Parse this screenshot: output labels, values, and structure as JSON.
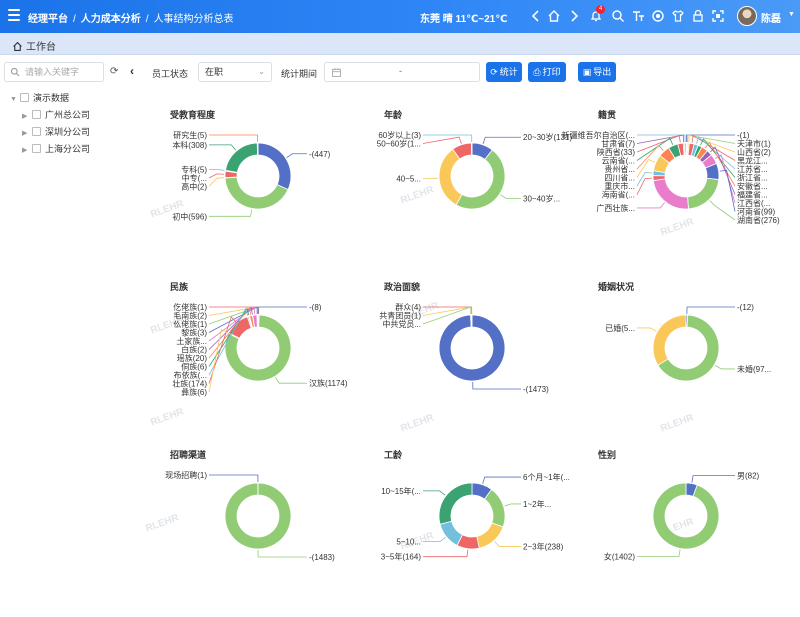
{
  "header": {
    "breadcrumb": [
      "经理平台",
      "人力成本分析",
      "人事结构分析总表"
    ],
    "weather": "东莞 晴 11℃~21℃",
    "notification_count": "4",
    "user_name": "陈磊"
  },
  "tabs": {
    "home_label": "工作台"
  },
  "sidebar": {
    "search_placeholder": "请输入关键字",
    "tree": [
      {
        "label": "演示数据",
        "level": 0
      },
      {
        "label": "广州总公司",
        "level": 1
      },
      {
        "label": "深圳分公司",
        "level": 1
      },
      {
        "label": "上海分公司",
        "level": 1
      }
    ]
  },
  "filters": {
    "status_label": "员工状态",
    "status_value": "在职",
    "period_label": "统计期间",
    "period_separator": "-"
  },
  "buttons": {
    "stat": "统计",
    "print": "打印",
    "export": "导出"
  },
  "watermark": "RLEHR",
  "chart_data": [
    {
      "type": "pie",
      "title": "受教育程度",
      "slices": [
        {
          "label": "-(447)",
          "value": 447,
          "color": "#5470c6"
        },
        {
          "label": "初中(596)",
          "value": 596,
          "color": "#91cc75"
        },
        {
          "label": "高中(2)",
          "value": 2,
          "color": "#fac858"
        },
        {
          "label": "中专(...",
          "value": 45,
          "color": "#ee6666"
        },
        {
          "label": "专科(5)",
          "value": 5,
          "color": "#73c0de"
        },
        {
          "label": "本科(308)",
          "value": 308,
          "color": "#3ba272"
        },
        {
          "label": "研究生(5)",
          "value": 5,
          "color": "#fc8452"
        }
      ]
    },
    {
      "type": "pie",
      "title": "年龄",
      "slices": [
        {
          "label": "20~30岁(131)",
          "value": 131,
          "color": "#5470c6"
        },
        {
          "label": "30~40岁...",
          "value": 590,
          "color": "#91cc75"
        },
        {
          "label": "40~5...",
          "value": 400,
          "color": "#fac858"
        },
        {
          "label": "50~60岁(1...",
          "value": 120,
          "color": "#ee6666"
        },
        {
          "label": "60岁以上(3)",
          "value": 3,
          "color": "#73c0de"
        }
      ]
    },
    {
      "type": "pie",
      "title": "籍贯",
      "slices": [
        {
          "label": "-(1)",
          "value": 6,
          "color": "#5470c6"
        },
        {
          "label": "天津市(1)",
          "value": 6,
          "color": "#91cc75"
        },
        {
          "label": "山西省(2)",
          "value": 8,
          "color": "#fac858"
        },
        {
          "label": "黑龙江...",
          "value": 30,
          "color": "#ee6666"
        },
        {
          "label": "江苏省...",
          "value": 25,
          "color": "#73c0de"
        },
        {
          "label": "浙江省...",
          "value": 25,
          "color": "#3ba272"
        },
        {
          "label": "安徽省...",
          "value": 40,
          "color": "#fc8452"
        },
        {
          "label": "福建省...",
          "value": 35,
          "color": "#9a60b4"
        },
        {
          "label": "江西省(...",
          "value": 60,
          "color": "#ea7ccc"
        },
        {
          "label": "河南省(99)",
          "value": 99,
          "color": "#5470c6"
        },
        {
          "label": "湖南省(276)",
          "value": 276,
          "color": "#91cc75"
        },
        {
          "label": "广西壮族...",
          "value": 300,
          "color": "#ea7ccc"
        },
        {
          "label": "海南省(...",
          "value": 30,
          "color": "#ee6666"
        },
        {
          "label": "重庆市...",
          "value": 30,
          "color": "#73c0de"
        },
        {
          "label": "四川省...",
          "value": 100,
          "color": "#fac858"
        },
        {
          "label": "贵州省...",
          "value": 70,
          "color": "#fc8452"
        },
        {
          "label": "云南省(...",
          "value": 60,
          "color": "#3ba272"
        },
        {
          "label": "陕西省(33)",
          "value": 33,
          "color": "#ee6666"
        },
        {
          "label": "甘肃省(7)",
          "value": 7,
          "color": "#9a60b4"
        },
        {
          "label": "新疆维吾尔自治区(...",
          "value": 10,
          "color": "#73c0de"
        }
      ]
    },
    {
      "type": "pie",
      "title": "民族",
      "slices": [
        {
          "label": "-(8)",
          "value": 8,
          "color": "#5470c6"
        },
        {
          "label": "汉族(1174)",
          "value": 1174,
          "color": "#91cc75"
        },
        {
          "label": "彝族(6)",
          "value": 6,
          "color": "#fac858"
        },
        {
          "label": "壮族(174)",
          "value": 174,
          "color": "#ee6666"
        },
        {
          "label": "布依族(...",
          "value": 10,
          "color": "#73c0de"
        },
        {
          "label": "侗族(6)",
          "value": 6,
          "color": "#3ba272"
        },
        {
          "label": "瑶族(20)",
          "value": 20,
          "color": "#fc8452"
        },
        {
          "label": "白族(2)",
          "value": 2,
          "color": "#9a60b4"
        },
        {
          "label": "土家族...",
          "value": 30,
          "color": "#ea7ccc"
        },
        {
          "label": "黎族(3)",
          "value": 3,
          "color": "#5470c6"
        },
        {
          "label": "仫佬族(1)",
          "value": 1,
          "color": "#91cc75"
        },
        {
          "label": "毛南族(2)",
          "value": 2,
          "color": "#fac858"
        },
        {
          "label": "仡佬族(1)",
          "value": 1,
          "color": "#ee6666"
        }
      ]
    },
    {
      "type": "pie",
      "title": "政治面貌",
      "slices": [
        {
          "label": "-(1473)",
          "value": 1473,
          "color": "#5470c6"
        },
        {
          "label": "中共党员...",
          "value": 5,
          "color": "#91cc75"
        },
        {
          "label": "共青团员(1)",
          "value": 1,
          "color": "#fac858"
        },
        {
          "label": "群众(4)",
          "value": 4,
          "color": "#ee6666"
        }
      ]
    },
    {
      "type": "pie",
      "title": "婚姻状况",
      "slices": [
        {
          "label": "-(12)",
          "value": 12,
          "color": "#5470c6"
        },
        {
          "label": "未婚(97...",
          "value": 970,
          "color": "#91cc75"
        },
        {
          "label": "已婚(5...",
          "value": 500,
          "color": "#fac858"
        }
      ]
    },
    {
      "type": "pie",
      "title": "招聘渠道",
      "slices": [
        {
          "label": "-(1483)",
          "value": 1483,
          "color": "#91cc75"
        },
        {
          "label": "现场招聘(1)",
          "value": 1,
          "color": "#5470c6"
        }
      ]
    },
    {
      "type": "pie",
      "title": "工龄",
      "slices": [
        {
          "label": "6个月~1年(...",
          "value": 150,
          "color": "#5470c6"
        },
        {
          "label": "1~2年...",
          "value": 300,
          "color": "#91cc75"
        },
        {
          "label": "2~3年(238)",
          "value": 238,
          "color": "#fac858"
        },
        {
          "label": "3~5年(164)",
          "value": 164,
          "color": "#ee6666"
        },
        {
          "label": "5~10...",
          "value": 200,
          "color": "#73c0de"
        },
        {
          "label": "10~15年(...",
          "value": 430,
          "color": "#3ba272"
        }
      ]
    },
    {
      "type": "pie",
      "title": "性别",
      "slices": [
        {
          "label": "男(82)",
          "value": 82,
          "color": "#5470c6"
        },
        {
          "label": "女(1402)",
          "value": 1402,
          "color": "#91cc75"
        }
      ]
    }
  ]
}
